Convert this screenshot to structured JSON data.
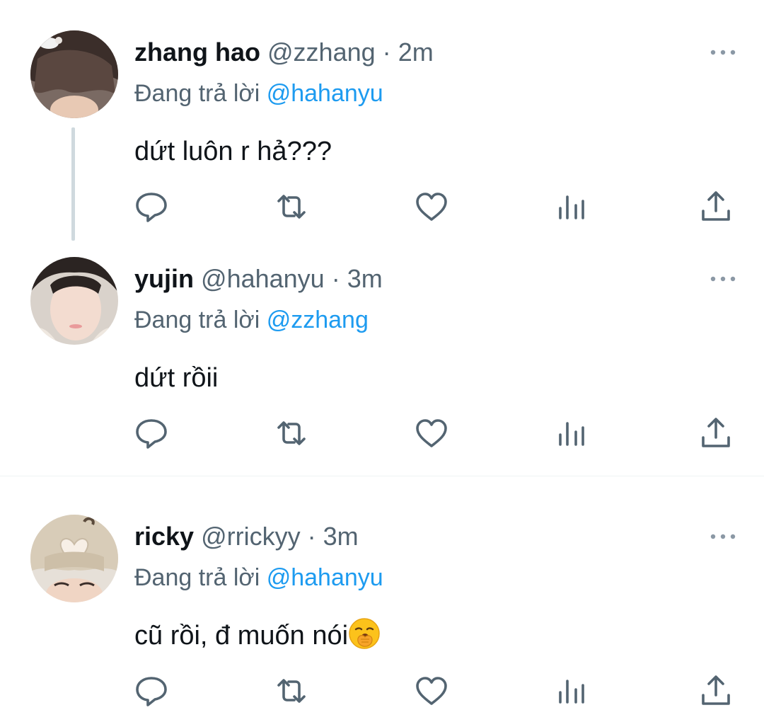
{
  "replies": [
    {
      "name": "zhang hao",
      "handle": "@zzhang",
      "separator": "·",
      "time": "2m",
      "reply_prefix": "Đang trả lời",
      "reply_to": "@hahanyu",
      "text": "dứt luôn r hả???"
    },
    {
      "name": "yujin",
      "handle": "@hahanyu",
      "separator": "·",
      "time": "3m",
      "reply_prefix": "Đang trả lời",
      "reply_to": "@zzhang",
      "text": "dứt rồii"
    },
    {
      "name": "ricky",
      "handle": "@rrickyy",
      "separator": "·",
      "time": "3m",
      "reply_prefix": "Đang trả lời",
      "reply_to": "@hahanyu",
      "text": "cũ rồi, đ muốn nói",
      "emoji": "yawning-face"
    }
  ],
  "icons": {
    "reply": "reply-icon",
    "retweet": "retweet-icon",
    "like": "like-icon",
    "views": "views-icon",
    "share": "share-icon",
    "more": "more-icon"
  },
  "colors": {
    "text": "#0f1419",
    "secondary": "#536471",
    "mention": "#1d9bf0",
    "thread_line": "#cfd9de",
    "divider": "#eff3f4"
  }
}
